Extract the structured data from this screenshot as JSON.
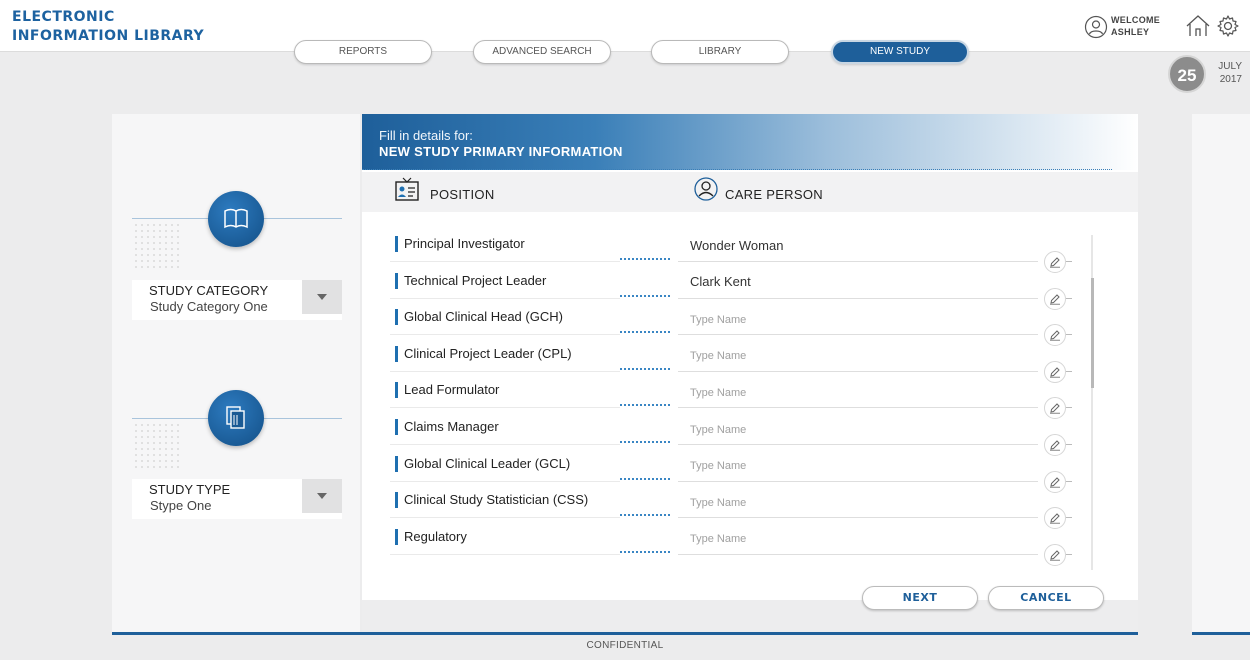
{
  "app": {
    "title_line1": "ELECTRONIC",
    "title_line2": "INFORMATION LIBRARY"
  },
  "nav": {
    "tabs": [
      {
        "label": "REPORTS",
        "active": false
      },
      {
        "label": "ADVANCED SEARCH",
        "active": false
      },
      {
        "label": "LIBRARY",
        "active": false
      },
      {
        "label": "NEW STUDY",
        "active": true
      }
    ]
  },
  "user": {
    "welcome": "WELCOME",
    "name": "ASHLEY"
  },
  "date": {
    "day": "25",
    "month": "JULY",
    "year": "2017"
  },
  "sidebar": {
    "category": {
      "label": "STUDY CATEGORY",
      "value": "Study Category One"
    },
    "type": {
      "label": "STUDY TYPE",
      "value": "Stype One"
    }
  },
  "form": {
    "subtitle": "Fill in details for:",
    "title": "NEW STUDY PRIMARY INFORMATION",
    "col_position": "POSITION",
    "col_care_person": "CARE PERSON",
    "name_placeholder": "Type Name",
    "rows": [
      {
        "position": "Principal Investigator",
        "name": "Wonder Woman"
      },
      {
        "position": "Technical Project Leader",
        "name": "Clark Kent"
      },
      {
        "position": "Global Clinical Head (GCH)",
        "name": ""
      },
      {
        "position": "Clinical Project Leader (CPL)",
        "name": ""
      },
      {
        "position": "Lead Formulator",
        "name": ""
      },
      {
        "position": "Claims Manager",
        "name": ""
      },
      {
        "position": "Global Clinical Leader (GCL)",
        "name": ""
      },
      {
        "position": "Clinical Study Statistician (CSS)",
        "name": ""
      },
      {
        "position": "Regulatory",
        "name": ""
      }
    ],
    "next_label": "NEXT",
    "cancel_label": "CANCEL"
  },
  "footer": {
    "confidential": "CONFIDENTIAL"
  },
  "colors": {
    "brand_blue": "#1e5f9a",
    "accent_blue": "#1e6fb0"
  }
}
